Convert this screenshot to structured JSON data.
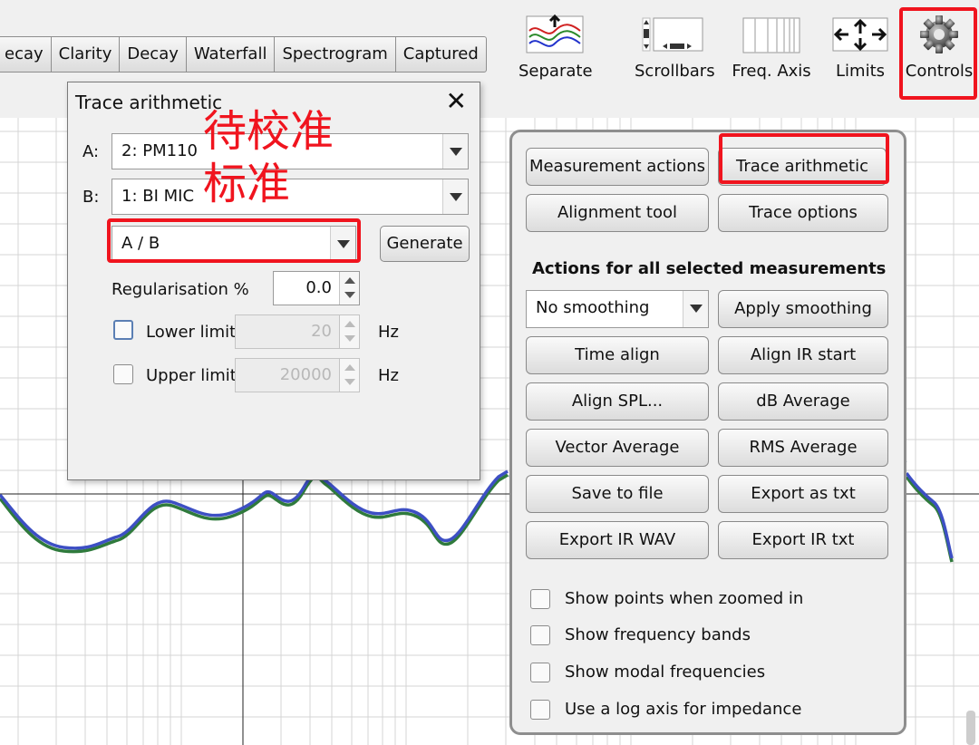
{
  "tabs": [
    "ecay",
    "Clarity",
    "Decay",
    "Waterfall",
    "Spectrogram",
    "Captured"
  ],
  "toolbar": {
    "separate": "Separate",
    "scrollbars": "Scrollbars",
    "freq_axis": "Freq. Axis",
    "limits": "Limits",
    "controls": "Controls"
  },
  "dialog": {
    "title": "Trace arithmetic",
    "close": "✕",
    "a_label": "A:",
    "a_value": "2: PM110",
    "b_label": "B:",
    "b_value": "1: BI MIC",
    "operation": "A / B",
    "generate": "Generate",
    "regularisation_label": "Regularisation %",
    "regularisation_value": "0.0",
    "lower_limit_label": "Lower limit",
    "lower_limit_value": "20",
    "upper_limit_label": "Upper limit",
    "upper_limit_value": "20000",
    "hz": "Hz"
  },
  "annotation": {
    "line1": "待校准",
    "line2": "标准",
    "color": "#f0141e"
  },
  "controls": {
    "measurement_actions": "Measurement actions",
    "trace_arithmetic": "Trace arithmetic",
    "alignment_tool": "Alignment tool",
    "trace_options": "Trace options",
    "section_heading": "Actions for all selected measurements",
    "smoothing_value": "No  smoothing",
    "apply_smoothing": "Apply smoothing",
    "time_align": "Time align",
    "align_ir_start": "Align IR start",
    "align_spl": "Align SPL...",
    "db_average": "dB Average",
    "vector_average": "Vector Average",
    "rms_average": "RMS Average",
    "save_to_file": "Save to file",
    "export_as_txt": "Export as txt",
    "export_ir_wav": "Export IR WAV",
    "export_ir_txt": "Export IR txt",
    "options": [
      "Show points when zoomed in",
      "Show frequency bands",
      "Show modal frequencies",
      "Use a log axis for impedance"
    ]
  },
  "colors": {
    "highlight": "#f0141e",
    "trace_blue": "#3d4fc4",
    "trace_green": "#2f7a3c",
    "trace_faint": "#b9c8d4"
  }
}
